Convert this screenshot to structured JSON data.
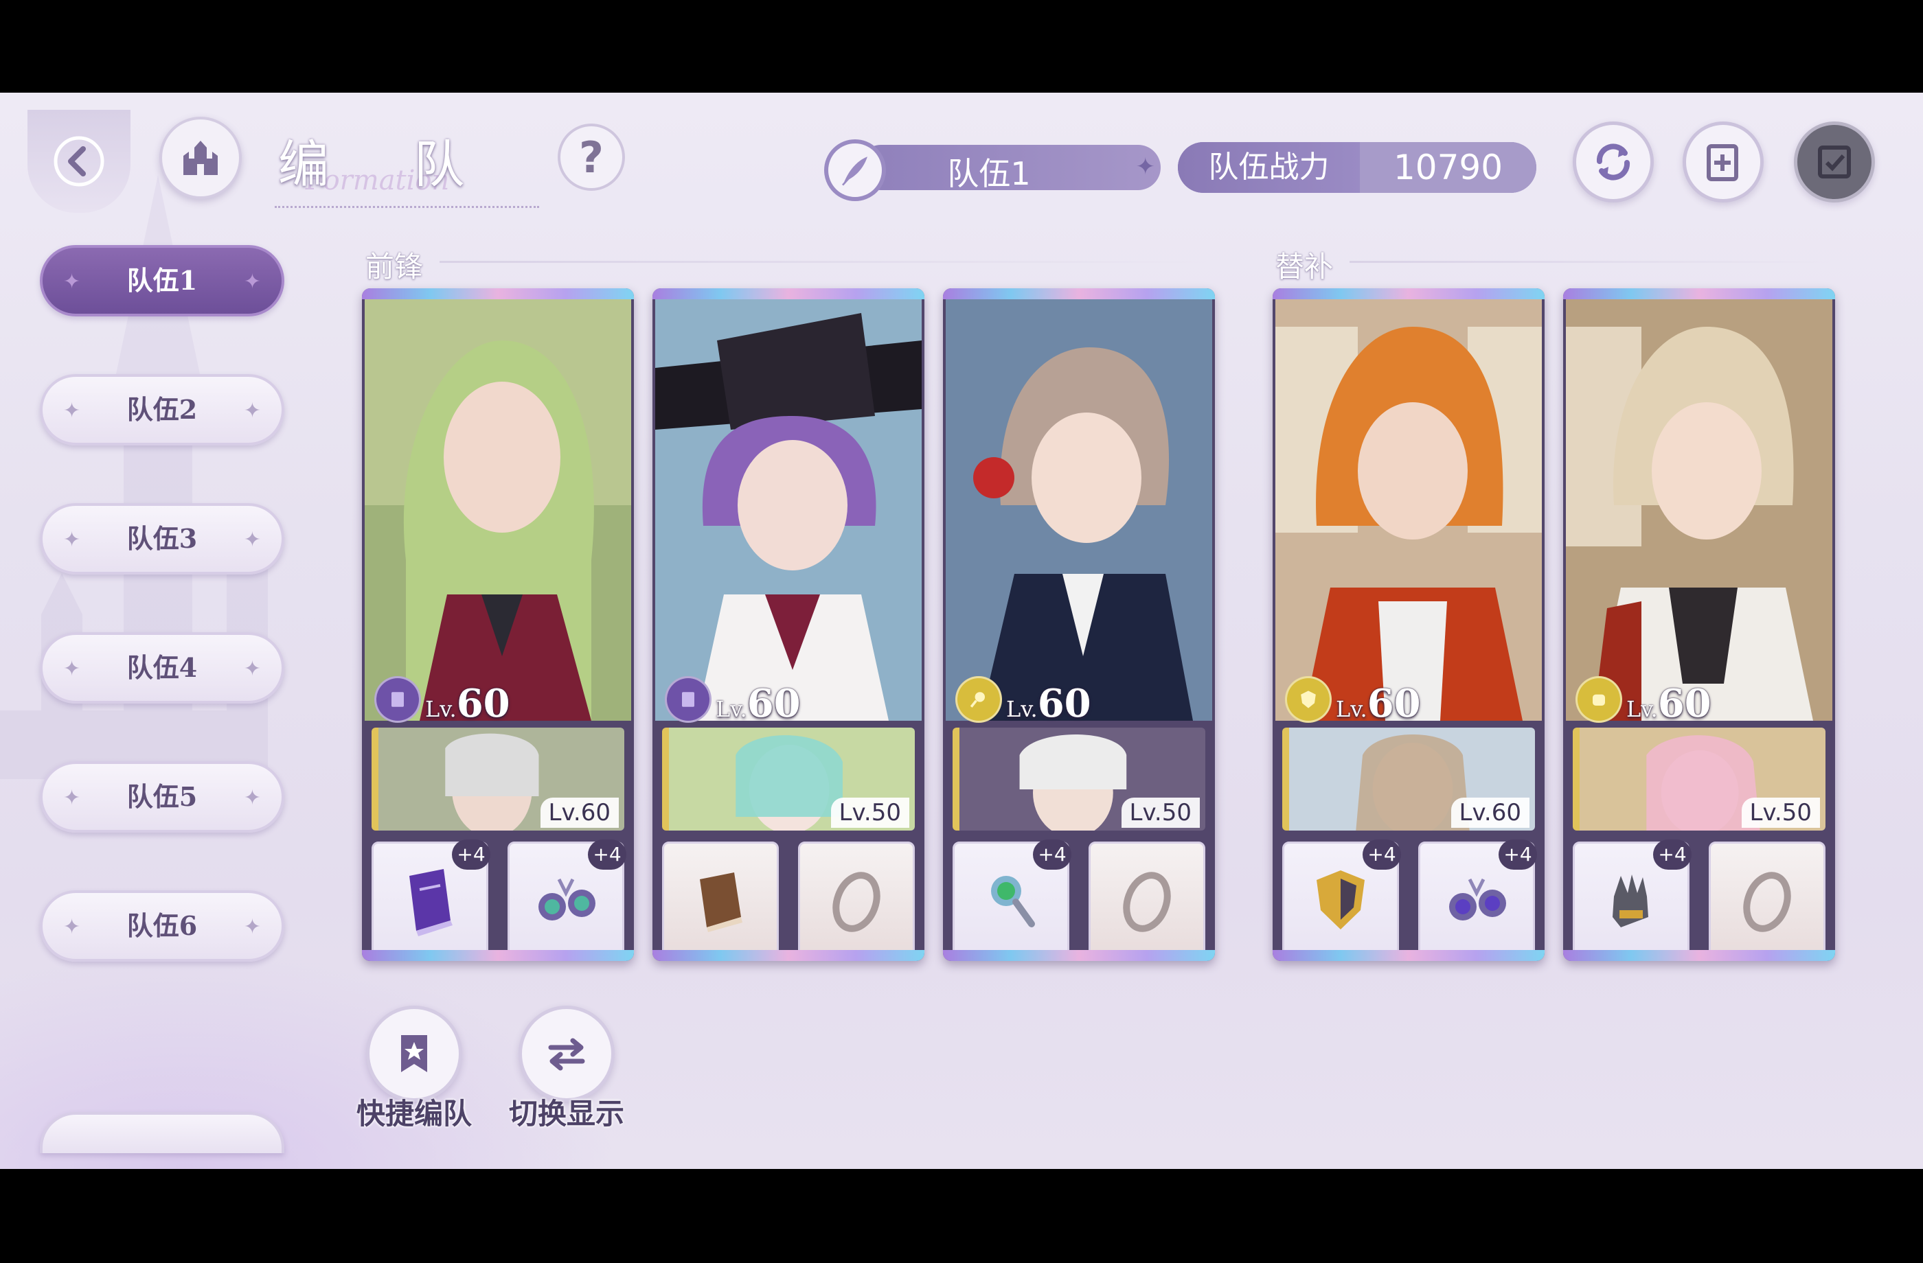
{
  "header": {
    "title": "编 队",
    "title_script": "Formation",
    "current_team": "队伍1",
    "power_label": "队伍战力",
    "power_value": "10790"
  },
  "sidebar": {
    "teams": [
      {
        "label": "队伍1",
        "active": true
      },
      {
        "label": "队伍2",
        "active": false
      },
      {
        "label": "队伍3",
        "active": false
      },
      {
        "label": "队伍4",
        "active": false
      },
      {
        "label": "队伍5",
        "active": false
      },
      {
        "label": "队伍6",
        "active": false
      }
    ]
  },
  "sections": {
    "front": "前锋",
    "sub": "替补"
  },
  "cards": [
    {
      "lv_prefix": "Lv.",
      "level": "60",
      "role_icon": "book-role-icon",
      "role_color": "#6e52a8",
      "support_level": "Lv.60",
      "equip1_plus": "+4",
      "equip2_plus": "+4",
      "equip1": "tome-icon",
      "equip2": "earring-icon"
    },
    {
      "lv_prefix": "Lv.",
      "level": "60",
      "role_icon": "book-role-icon",
      "role_color": "#6e52a8",
      "support_level": "Lv.50",
      "equip1_plus": "",
      "equip2_plus": "",
      "equip1": "book-icon",
      "equip2": "ring-icon"
    },
    {
      "lv_prefix": "Lv.",
      "level": "60",
      "role_icon": "wand-role-icon",
      "role_color": "#d8bd3c",
      "support_level": "Lv.50",
      "equip1_plus": "+4",
      "equip2_plus": "",
      "equip1": "magnifier-icon",
      "equip2": "ring-icon"
    },
    {
      "lv_prefix": "Lv.",
      "level": "60",
      "role_icon": "shield-role-icon",
      "role_color": "#d8bd3c",
      "support_level": "Lv.60",
      "equip1_plus": "+4",
      "equip2_plus": "+4",
      "equip1": "shield-icon",
      "equip2": "earring-icon"
    },
    {
      "lv_prefix": "Lv.",
      "level": "60",
      "role_icon": "fist-role-icon",
      "role_color": "#d8bd3c",
      "support_level": "Lv.50",
      "equip1_plus": "+4",
      "equip2_plus": "",
      "equip1": "gauntlet-icon",
      "equip2": "ring-icon"
    }
  ],
  "actions": {
    "quick_formation": "快捷编队",
    "switch_display": "切换显示"
  },
  "colors": {
    "accent": "#8f80ba",
    "active_tab": "#7a5aa5",
    "text_dark": "#4d4267"
  }
}
